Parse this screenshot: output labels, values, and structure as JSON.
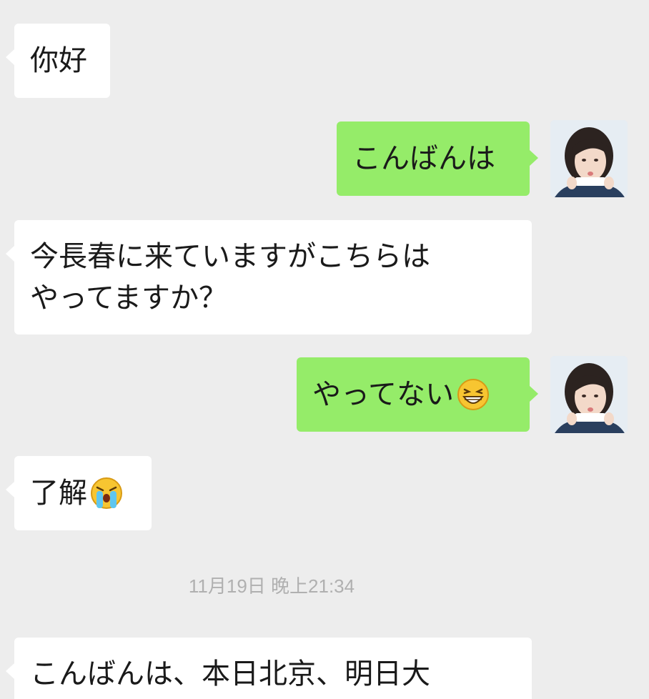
{
  "messages": [
    {
      "side": "incoming",
      "text": "你好"
    },
    {
      "side": "outgoing",
      "text": "こんばんは"
    },
    {
      "side": "incoming",
      "lines": [
        "今長春に来ていますがこちらは",
        "やってますか？"
      ]
    },
    {
      "side": "outgoing",
      "text": "やってない",
      "emoji": "grinning-squint-emoji"
    },
    {
      "side": "incoming",
      "text": "了解",
      "emoji": "crying-emoji"
    },
    {
      "side": "incoming",
      "text": "こんばんは、本日北京、明日大"
    }
  ],
  "timestamp": "11月19日 晚上21:34",
  "colors": {
    "background": "#ededed",
    "incoming_bubble": "#ffffff",
    "outgoing_bubble": "#95ec69",
    "timestamp_text": "#b0b0b0"
  },
  "icons": {
    "self_avatar": "woman-photo-avatar"
  }
}
